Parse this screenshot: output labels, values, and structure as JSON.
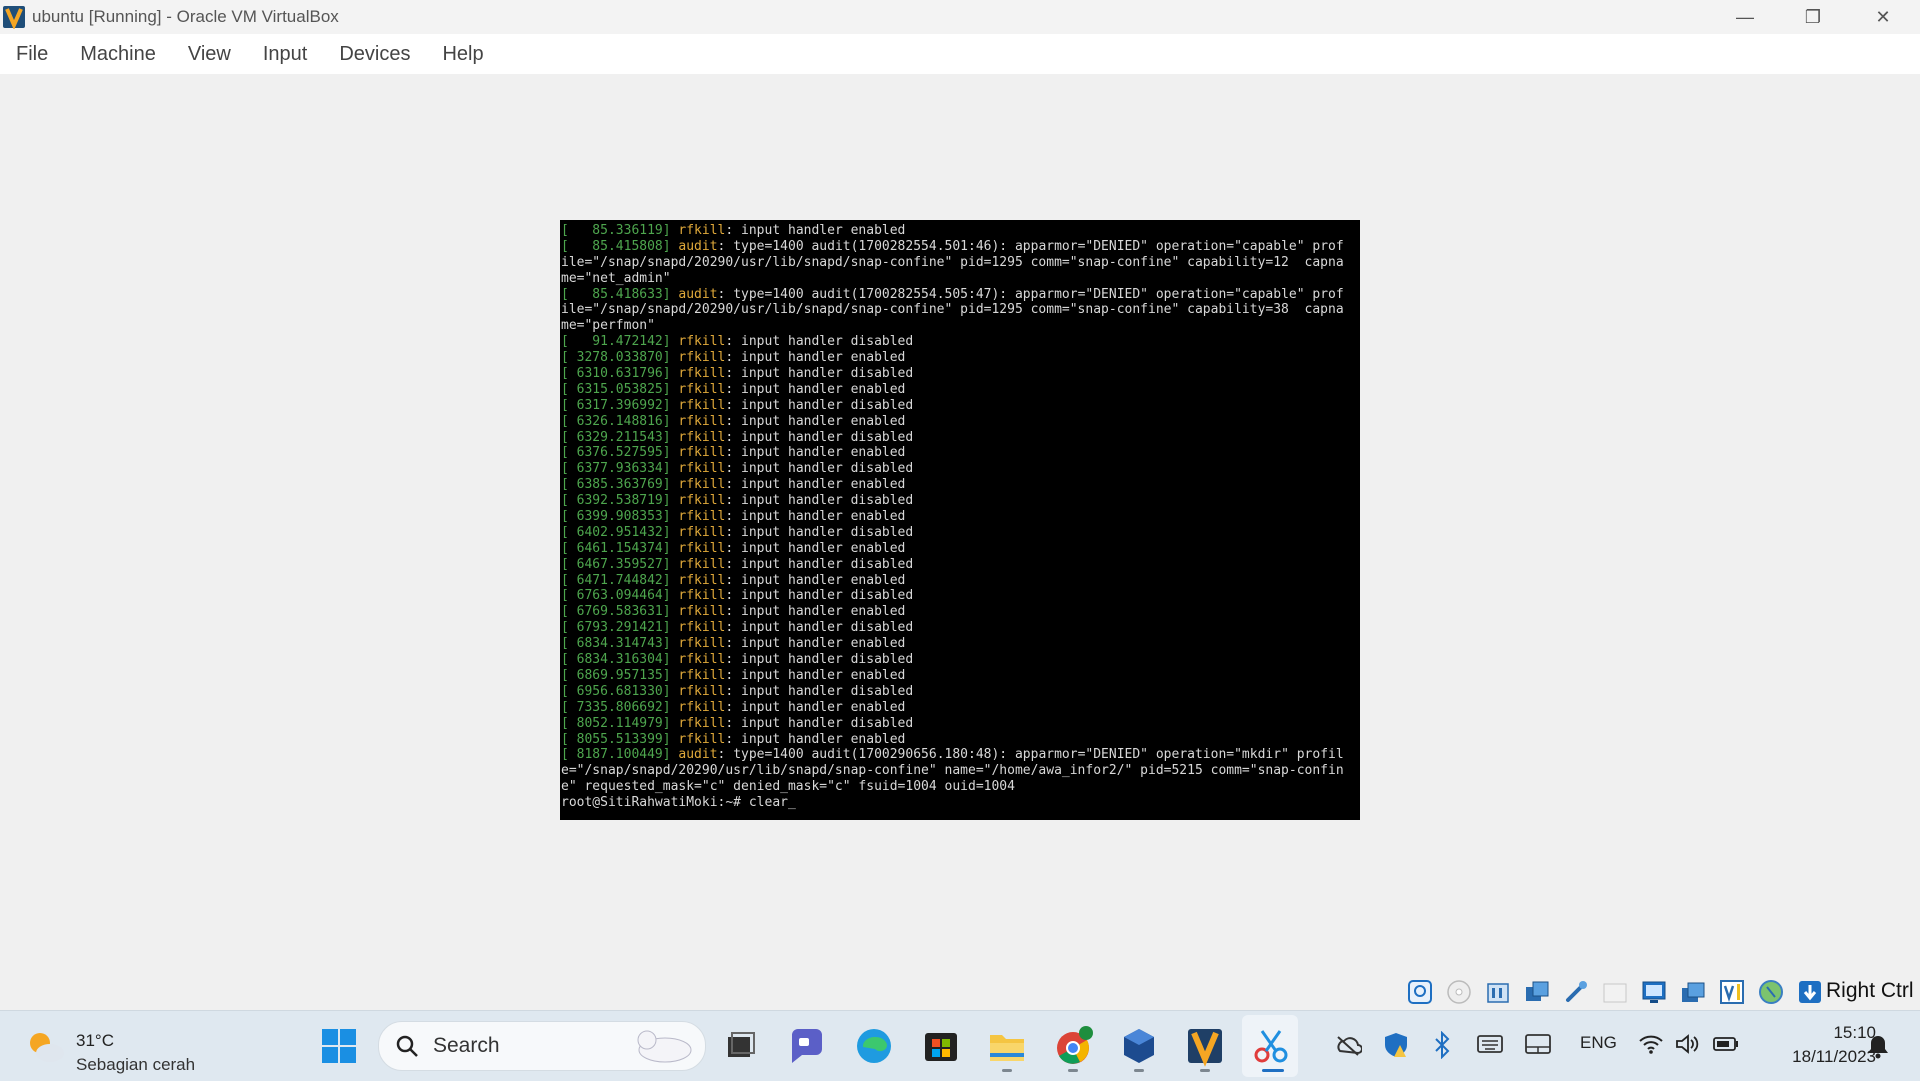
{
  "window": {
    "title": "ubuntu [Running] - Oracle VM VirtualBox",
    "controls": {
      "minimize": "—",
      "maximize": "❐",
      "close": "✕"
    }
  },
  "menu": [
    "File",
    "Machine",
    "View",
    "Input",
    "Devices",
    "Help"
  ],
  "console": {
    "lines": [
      {
        "ts": "[   85.336119]",
        "src": "rfkill",
        "msg": ": input handler enabled"
      },
      {
        "ts": "[   85.415808]",
        "src": "audit",
        "msg": ": type=1400 audit(1700282554.501:46): apparmor=\"DENIED\" operation=\"capable\" prof"
      },
      {
        "ts": "",
        "src": "",
        "msg": "ile=\"/snap/snapd/20290/usr/lib/snapd/snap-confine\" pid=1295 comm=\"snap-confine\" capability=12  capna"
      },
      {
        "ts": "",
        "src": "",
        "msg": "me=\"net_admin\""
      },
      {
        "ts": "[   85.418633]",
        "src": "audit",
        "msg": ": type=1400 audit(1700282554.505:47): apparmor=\"DENIED\" operation=\"capable\" prof"
      },
      {
        "ts": "",
        "src": "",
        "msg": "ile=\"/snap/snapd/20290/usr/lib/snapd/snap-confine\" pid=1295 comm=\"snap-confine\" capability=38  capna"
      },
      {
        "ts": "",
        "src": "",
        "msg": "me=\"perfmon\""
      },
      {
        "ts": "[   91.472142]",
        "src": "rfkill",
        "msg": ": input handler disabled"
      },
      {
        "ts": "[ 3278.033870]",
        "src": "rfkill",
        "msg": ": input handler enabled"
      },
      {
        "ts": "[ 6310.631796]",
        "src": "rfkill",
        "msg": ": input handler disabled"
      },
      {
        "ts": "[ 6315.053825]",
        "src": "rfkill",
        "msg": ": input handler enabled"
      },
      {
        "ts": "[ 6317.396992]",
        "src": "rfkill",
        "msg": ": input handler disabled"
      },
      {
        "ts": "[ 6326.148816]",
        "src": "rfkill",
        "msg": ": input handler enabled"
      },
      {
        "ts": "[ 6329.211543]",
        "src": "rfkill",
        "msg": ": input handler disabled"
      },
      {
        "ts": "[ 6376.527595]",
        "src": "rfkill",
        "msg": ": input handler enabled"
      },
      {
        "ts": "[ 6377.936334]",
        "src": "rfkill",
        "msg": ": input handler disabled"
      },
      {
        "ts": "[ 6385.363769]",
        "src": "rfkill",
        "msg": ": input handler enabled"
      },
      {
        "ts": "[ 6392.538719]",
        "src": "rfkill",
        "msg": ": input handler disabled"
      },
      {
        "ts": "[ 6399.908353]",
        "src": "rfkill",
        "msg": ": input handler enabled"
      },
      {
        "ts": "[ 6402.951432]",
        "src": "rfkill",
        "msg": ": input handler disabled"
      },
      {
        "ts": "[ 6461.154374]",
        "src": "rfkill",
        "msg": ": input handler enabled"
      },
      {
        "ts": "[ 6467.359527]",
        "src": "rfkill",
        "msg": ": input handler disabled"
      },
      {
        "ts": "[ 6471.744842]",
        "src": "rfkill",
        "msg": ": input handler enabled"
      },
      {
        "ts": "[ 6763.094464]",
        "src": "rfkill",
        "msg": ": input handler disabled"
      },
      {
        "ts": "[ 6769.583631]",
        "src": "rfkill",
        "msg": ": input handler enabled"
      },
      {
        "ts": "[ 6793.291421]",
        "src": "rfkill",
        "msg": ": input handler disabled"
      },
      {
        "ts": "[ 6834.314743]",
        "src": "rfkill",
        "msg": ": input handler enabled"
      },
      {
        "ts": "[ 6834.316304]",
        "src": "rfkill",
        "msg": ": input handler disabled"
      },
      {
        "ts": "[ 6869.957135]",
        "src": "rfkill",
        "msg": ": input handler enabled"
      },
      {
        "ts": "[ 6956.681330]",
        "src": "rfkill",
        "msg": ": input handler disabled"
      },
      {
        "ts": "[ 7335.806692]",
        "src": "rfkill",
        "msg": ": input handler enabled"
      },
      {
        "ts": "[ 8052.114979]",
        "src": "rfkill",
        "msg": ": input handler disabled"
      },
      {
        "ts": "[ 8055.513399]",
        "src": "rfkill",
        "msg": ": input handler enabled"
      },
      {
        "ts": "[ 8187.100449]",
        "src": "audit",
        "msg": ": type=1400 audit(1700290656.180:48): apparmor=\"DENIED\" operation=\"mkdir\" profil"
      },
      {
        "ts": "",
        "src": "",
        "msg": "e=\"/snap/snapd/20290/usr/lib/snapd/snap-confine\" name=\"/home/awa_infor2/\" pid=5215 comm=\"snap-confin"
      },
      {
        "ts": "",
        "src": "",
        "msg": "e\" requested_mask=\"c\" denied_mask=\"c\" fsuid=1004 ouid=1004"
      },
      {
        "ts": "",
        "src": "",
        "msg": "root@SitiRahwatiMoki:~# clear_"
      }
    ]
  },
  "status_bar": {
    "icons": [
      "hard-disk-icon",
      "optical-drive-icon",
      "audio-icon",
      "network-icon",
      "usb-icon",
      "shared-folders-icon",
      "display-icon",
      "recording-icon",
      "cpu-icon",
      "mouse-integration-icon",
      "keyboard-capture-icon"
    ],
    "host_key": "Right Ctrl"
  },
  "taskbar": {
    "weather_temp": "31°C",
    "weather_desc": "Sebagian cerah",
    "search_label": "Search",
    "apps": [
      "start-icon",
      "task-view-icon",
      "teams-chat-icon",
      "edge-icon",
      "store-icon",
      "file-explorer-icon",
      "chrome-icon",
      "virtualbox-icon",
      "virtualbox-vm-icon",
      "snipping-tool-icon"
    ],
    "tray": {
      "language": "ENG"
    },
    "clock_time": "15:10",
    "clock_date": "18/11/2023"
  },
  "colors": {
    "timestamp": "#4ea64e",
    "source": "#e0a93a",
    "console_text": "#d8d8d8",
    "console_bg": "#000000",
    "taskbar_bg": "#dfe8f0"
  }
}
